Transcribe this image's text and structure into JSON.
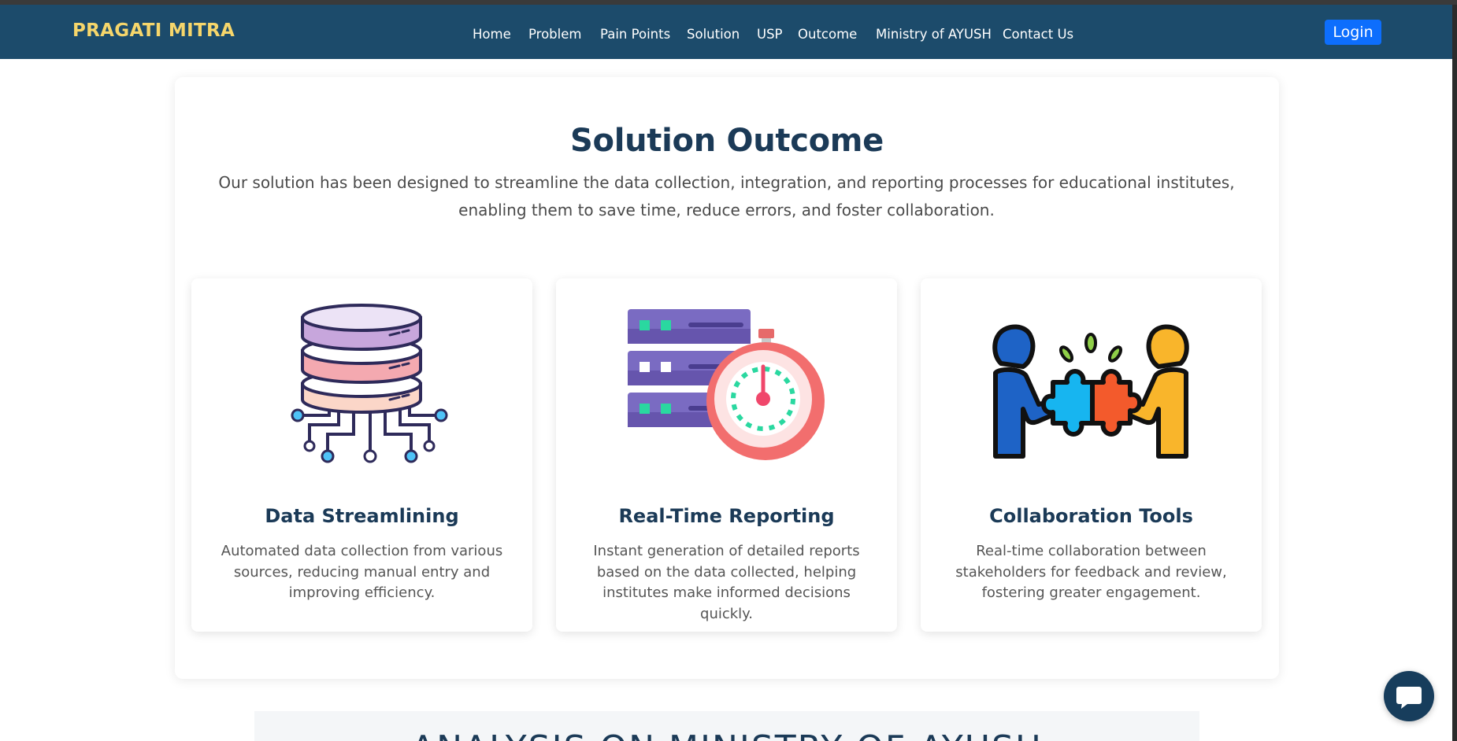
{
  "navbar": {
    "brand": "PRAGATI MITRA",
    "items": [
      {
        "label": "Home"
      },
      {
        "label": "Problem"
      },
      {
        "label": "Pain Points"
      },
      {
        "label": "Solution"
      },
      {
        "label": "USP"
      },
      {
        "label": "Outcome"
      },
      {
        "label": "Ministry of AYUSH"
      },
      {
        "label": "Contact Us"
      }
    ],
    "login_label": "Login"
  },
  "section": {
    "title": "Solution Outcome",
    "subtitle": "Our solution has been designed to streamline the data collection, integration, and reporting processes for educational institutes, enabling them to save time, reduce errors, and foster collaboration."
  },
  "cards": [
    {
      "icon": "database-icon",
      "title": "Data Streamlining",
      "text": "Automated data collection from various sources, reducing manual entry and improving efficiency."
    },
    {
      "icon": "server-stopwatch-icon",
      "title": "Real-Time Reporting",
      "text": "Instant generation of detailed reports based on the data collected, helping institutes make informed decisions quickly."
    },
    {
      "icon": "collaboration-puzzle-icon",
      "title": "Collaboration Tools",
      "text": "Real-time collaboration between stakeholders for feedback and review, fostering greater engagement."
    }
  ],
  "next_section": {
    "title": "ANALYSIS ON MINISTRY OF AYUSH"
  },
  "colors": {
    "navbar_bg": "#1c4b6b",
    "brand": "#f6d66b",
    "login_bg": "#0d6efd",
    "heading": "#1b3a57",
    "chat_bg": "#173d5c"
  },
  "chat": {
    "icon": "chat-bubble-icon"
  }
}
